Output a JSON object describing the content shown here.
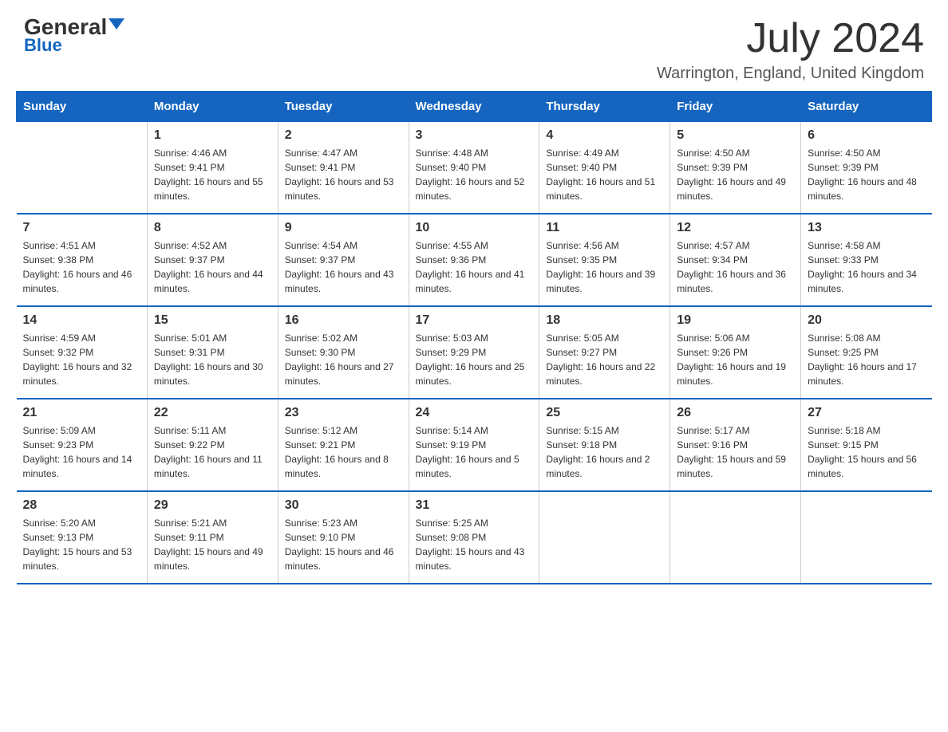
{
  "header": {
    "logo": {
      "general": "General",
      "blue": "Blue"
    },
    "title": "July 2024",
    "subtitle": "Warrington, England, United Kingdom"
  },
  "calendar": {
    "days_of_week": [
      "Sunday",
      "Monday",
      "Tuesday",
      "Wednesday",
      "Thursday",
      "Friday",
      "Saturday"
    ],
    "weeks": [
      [
        {
          "day": "",
          "sunrise": "",
          "sunset": "",
          "daylight": ""
        },
        {
          "day": "1",
          "sunrise": "Sunrise: 4:46 AM",
          "sunset": "Sunset: 9:41 PM",
          "daylight": "Daylight: 16 hours and 55 minutes."
        },
        {
          "day": "2",
          "sunrise": "Sunrise: 4:47 AM",
          "sunset": "Sunset: 9:41 PM",
          "daylight": "Daylight: 16 hours and 53 minutes."
        },
        {
          "day": "3",
          "sunrise": "Sunrise: 4:48 AM",
          "sunset": "Sunset: 9:40 PM",
          "daylight": "Daylight: 16 hours and 52 minutes."
        },
        {
          "day": "4",
          "sunrise": "Sunrise: 4:49 AM",
          "sunset": "Sunset: 9:40 PM",
          "daylight": "Daylight: 16 hours and 51 minutes."
        },
        {
          "day": "5",
          "sunrise": "Sunrise: 4:50 AM",
          "sunset": "Sunset: 9:39 PM",
          "daylight": "Daylight: 16 hours and 49 minutes."
        },
        {
          "day": "6",
          "sunrise": "Sunrise: 4:50 AM",
          "sunset": "Sunset: 9:39 PM",
          "daylight": "Daylight: 16 hours and 48 minutes."
        }
      ],
      [
        {
          "day": "7",
          "sunrise": "Sunrise: 4:51 AM",
          "sunset": "Sunset: 9:38 PM",
          "daylight": "Daylight: 16 hours and 46 minutes."
        },
        {
          "day": "8",
          "sunrise": "Sunrise: 4:52 AM",
          "sunset": "Sunset: 9:37 PM",
          "daylight": "Daylight: 16 hours and 44 minutes."
        },
        {
          "day": "9",
          "sunrise": "Sunrise: 4:54 AM",
          "sunset": "Sunset: 9:37 PM",
          "daylight": "Daylight: 16 hours and 43 minutes."
        },
        {
          "day": "10",
          "sunrise": "Sunrise: 4:55 AM",
          "sunset": "Sunset: 9:36 PM",
          "daylight": "Daylight: 16 hours and 41 minutes."
        },
        {
          "day": "11",
          "sunrise": "Sunrise: 4:56 AM",
          "sunset": "Sunset: 9:35 PM",
          "daylight": "Daylight: 16 hours and 39 minutes."
        },
        {
          "day": "12",
          "sunrise": "Sunrise: 4:57 AM",
          "sunset": "Sunset: 9:34 PM",
          "daylight": "Daylight: 16 hours and 36 minutes."
        },
        {
          "day": "13",
          "sunrise": "Sunrise: 4:58 AM",
          "sunset": "Sunset: 9:33 PM",
          "daylight": "Daylight: 16 hours and 34 minutes."
        }
      ],
      [
        {
          "day": "14",
          "sunrise": "Sunrise: 4:59 AM",
          "sunset": "Sunset: 9:32 PM",
          "daylight": "Daylight: 16 hours and 32 minutes."
        },
        {
          "day": "15",
          "sunrise": "Sunrise: 5:01 AM",
          "sunset": "Sunset: 9:31 PM",
          "daylight": "Daylight: 16 hours and 30 minutes."
        },
        {
          "day": "16",
          "sunrise": "Sunrise: 5:02 AM",
          "sunset": "Sunset: 9:30 PM",
          "daylight": "Daylight: 16 hours and 27 minutes."
        },
        {
          "day": "17",
          "sunrise": "Sunrise: 5:03 AM",
          "sunset": "Sunset: 9:29 PM",
          "daylight": "Daylight: 16 hours and 25 minutes."
        },
        {
          "day": "18",
          "sunrise": "Sunrise: 5:05 AM",
          "sunset": "Sunset: 9:27 PM",
          "daylight": "Daylight: 16 hours and 22 minutes."
        },
        {
          "day": "19",
          "sunrise": "Sunrise: 5:06 AM",
          "sunset": "Sunset: 9:26 PM",
          "daylight": "Daylight: 16 hours and 19 minutes."
        },
        {
          "day": "20",
          "sunrise": "Sunrise: 5:08 AM",
          "sunset": "Sunset: 9:25 PM",
          "daylight": "Daylight: 16 hours and 17 minutes."
        }
      ],
      [
        {
          "day": "21",
          "sunrise": "Sunrise: 5:09 AM",
          "sunset": "Sunset: 9:23 PM",
          "daylight": "Daylight: 16 hours and 14 minutes."
        },
        {
          "day": "22",
          "sunrise": "Sunrise: 5:11 AM",
          "sunset": "Sunset: 9:22 PM",
          "daylight": "Daylight: 16 hours and 11 minutes."
        },
        {
          "day": "23",
          "sunrise": "Sunrise: 5:12 AM",
          "sunset": "Sunset: 9:21 PM",
          "daylight": "Daylight: 16 hours and 8 minutes."
        },
        {
          "day": "24",
          "sunrise": "Sunrise: 5:14 AM",
          "sunset": "Sunset: 9:19 PM",
          "daylight": "Daylight: 16 hours and 5 minutes."
        },
        {
          "day": "25",
          "sunrise": "Sunrise: 5:15 AM",
          "sunset": "Sunset: 9:18 PM",
          "daylight": "Daylight: 16 hours and 2 minutes."
        },
        {
          "day": "26",
          "sunrise": "Sunrise: 5:17 AM",
          "sunset": "Sunset: 9:16 PM",
          "daylight": "Daylight: 15 hours and 59 minutes."
        },
        {
          "day": "27",
          "sunrise": "Sunrise: 5:18 AM",
          "sunset": "Sunset: 9:15 PM",
          "daylight": "Daylight: 15 hours and 56 minutes."
        }
      ],
      [
        {
          "day": "28",
          "sunrise": "Sunrise: 5:20 AM",
          "sunset": "Sunset: 9:13 PM",
          "daylight": "Daylight: 15 hours and 53 minutes."
        },
        {
          "day": "29",
          "sunrise": "Sunrise: 5:21 AM",
          "sunset": "Sunset: 9:11 PM",
          "daylight": "Daylight: 15 hours and 49 minutes."
        },
        {
          "day": "30",
          "sunrise": "Sunrise: 5:23 AM",
          "sunset": "Sunset: 9:10 PM",
          "daylight": "Daylight: 15 hours and 46 minutes."
        },
        {
          "day": "31",
          "sunrise": "Sunrise: 5:25 AM",
          "sunset": "Sunset: 9:08 PM",
          "daylight": "Daylight: 15 hours and 43 minutes."
        },
        {
          "day": "",
          "sunrise": "",
          "sunset": "",
          "daylight": ""
        },
        {
          "day": "",
          "sunrise": "",
          "sunset": "",
          "daylight": ""
        },
        {
          "day": "",
          "sunrise": "",
          "sunset": "",
          "daylight": ""
        }
      ]
    ]
  }
}
